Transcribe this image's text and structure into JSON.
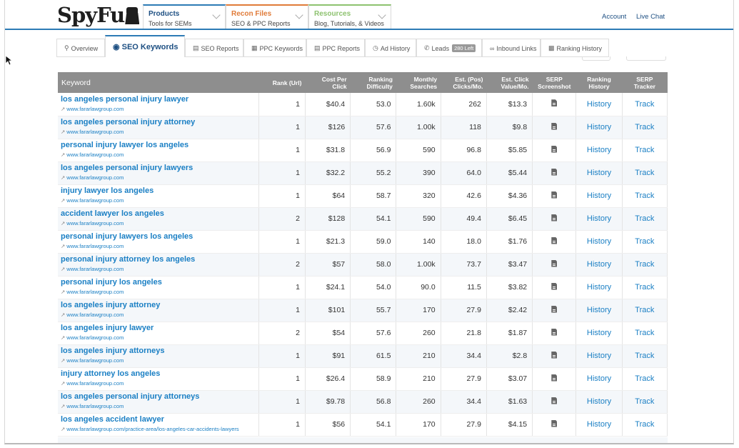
{
  "brand": {
    "logo": "SpyFu"
  },
  "menus": [
    {
      "title": "Products",
      "subtitle": "Tools for SEMs"
    },
    {
      "title": "Recon Files",
      "subtitle": "SEO & PPC Reports"
    },
    {
      "title": "Resources",
      "subtitle": "Blog, Tutorials, & Videos"
    }
  ],
  "top_links": {
    "account": "Account",
    "live_chat": "Live Chat"
  },
  "tabs": [
    {
      "label": "Overview",
      "icon": "search-icon"
    },
    {
      "label": "SEO Keywords",
      "icon": "globe-icon",
      "active": true
    },
    {
      "label": "SEO Reports",
      "icon": "doc-icon"
    },
    {
      "label": "PPC Keywords",
      "icon": "sitemap-icon"
    },
    {
      "label": "PPC Reports",
      "icon": "doc-icon"
    },
    {
      "label": "Ad History",
      "icon": "clock-icon"
    },
    {
      "label": "Leads",
      "icon": "phone-icon",
      "badge": "280 Left"
    },
    {
      "label": "Inbound Links",
      "icon": "link-icon"
    },
    {
      "label": "Ranking History",
      "icon": "chart-icon"
    }
  ],
  "table": {
    "headers": {
      "keyword": "Keyword",
      "rank": "Rank (Url)",
      "cpc_1": "Cost Per",
      "cpc_2": "Click",
      "diff_1": "Ranking",
      "diff_2": "Difficulty",
      "ms_1": "Monthly",
      "ms_2": "Searches",
      "ec_1": "Est. (Pos)",
      "ec_2": "Clicks/Mo.",
      "ev_1": "Est. Click",
      "ev_2": "Value/Mo.",
      "serp_1": "SERP",
      "serp_2": "Screenshot",
      "rh_1": "Ranking",
      "rh_2": "History",
      "st_1": "SERP",
      "st_2": "Tracker"
    },
    "history_label": "History",
    "track_label": "Track",
    "rows": [
      {
        "keyword": "los angeles personal injury lawyer",
        "url": "www.fararlawgroup.com",
        "rank": "1",
        "cpc": "$40.4",
        "difficulty": "53.0",
        "searches": "1.60k",
        "clicks": "262",
        "value": "$13.3"
      },
      {
        "keyword": "los angeles personal injury attorney",
        "url": "www.fararlawgroup.com",
        "rank": "1",
        "cpc": "$126",
        "difficulty": "57.6",
        "searches": "1.00k",
        "clicks": "118",
        "value": "$9.8"
      },
      {
        "keyword": "personal injury lawyer los angeles",
        "url": "www.fararlawgroup.com",
        "rank": "1",
        "cpc": "$31.8",
        "difficulty": "56.9",
        "searches": "590",
        "clicks": "96.8",
        "value": "$5.85"
      },
      {
        "keyword": "los angeles personal injury lawyers",
        "url": "www.fararlawgroup.com",
        "rank": "1",
        "cpc": "$32.2",
        "difficulty": "55.2",
        "searches": "390",
        "clicks": "64.0",
        "value": "$5.44"
      },
      {
        "keyword": "injury lawyer los angeles",
        "url": "www.fararlawgroup.com",
        "rank": "1",
        "cpc": "$64",
        "difficulty": "58.7",
        "searches": "320",
        "clicks": "42.6",
        "value": "$4.36"
      },
      {
        "keyword": "accident lawyer los angeles",
        "url": "www.fararlawgroup.com",
        "rank": "2",
        "cpc": "$128",
        "difficulty": "54.1",
        "searches": "590",
        "clicks": "49.4",
        "value": "$6.45"
      },
      {
        "keyword": "personal injury lawyers los angeles",
        "url": "www.fararlawgroup.com",
        "rank": "1",
        "cpc": "$21.3",
        "difficulty": "59.0",
        "searches": "140",
        "clicks": "18.0",
        "value": "$1.76"
      },
      {
        "keyword": "personal injury attorney los angeles",
        "url": "www.fararlawgroup.com",
        "rank": "2",
        "cpc": "$57",
        "difficulty": "58.0",
        "searches": "1.00k",
        "clicks": "73.7",
        "value": "$3.47"
      },
      {
        "keyword": "personal injury los angeles",
        "url": "www.fararlawgroup.com",
        "rank": "1",
        "cpc": "$24.1",
        "difficulty": "54.0",
        "searches": "90.0",
        "clicks": "11.5",
        "value": "$3.82"
      },
      {
        "keyword": "los angeles injury attorney",
        "url": "www.fararlawgroup.com",
        "rank": "1",
        "cpc": "$101",
        "difficulty": "55.7",
        "searches": "170",
        "clicks": "27.9",
        "value": "$2.42"
      },
      {
        "keyword": "los angeles injury lawyer",
        "url": "www.fararlawgroup.com",
        "rank": "2",
        "cpc": "$54",
        "difficulty": "57.6",
        "searches": "260",
        "clicks": "21.8",
        "value": "$1.87"
      },
      {
        "keyword": "los angeles injury attorneys",
        "url": "www.fararlawgroup.com",
        "rank": "1",
        "cpc": "$91",
        "difficulty": "61.5",
        "searches": "210",
        "clicks": "34.4",
        "value": "$2.8"
      },
      {
        "keyword": "injury attorney los angeles",
        "url": "www.fararlawgroup.com",
        "rank": "1",
        "cpc": "$26.4",
        "difficulty": "58.9",
        "searches": "210",
        "clicks": "27.9",
        "value": "$3.07"
      },
      {
        "keyword": "los angeles personal injury attorneys",
        "url": "www.fararlawgroup.com",
        "rank": "1",
        "cpc": "$9.78",
        "difficulty": "56.8",
        "searches": "260",
        "clicks": "34.4",
        "value": "$1.63"
      },
      {
        "keyword": "los angeles accident lawyer",
        "url": "www.fararlawgroup.com/practice-area/los-angeles-car-accidents-lawyers",
        "rank": "1",
        "cpc": "$56",
        "difficulty": "54.1",
        "searches": "170",
        "clicks": "27.9",
        "value": "$4.15"
      }
    ]
  }
}
